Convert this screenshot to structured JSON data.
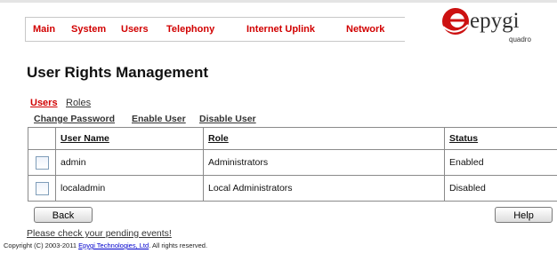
{
  "nav": {
    "items": [
      "Main",
      "System",
      "Users",
      "Telephony",
      "Internet Uplink",
      "Network"
    ]
  },
  "logo": {
    "text": "epygi",
    "subtext": "quadro"
  },
  "page": {
    "title": "User Rights Management"
  },
  "subtabs": {
    "users": "Users",
    "roles": "Roles"
  },
  "actions": {
    "change_password": "Change Password",
    "enable_user": "Enable User",
    "disable_user": "Disable User"
  },
  "table": {
    "headers": {
      "user_name": "User Name",
      "role": "Role",
      "status": "Status"
    },
    "rows": [
      {
        "user_name": "admin",
        "role": "Administrators",
        "status": "Enabled"
      },
      {
        "user_name": "localadmin",
        "role": "Local Administrators",
        "status": "Disabled"
      }
    ]
  },
  "buttons": {
    "back": "Back",
    "help": "Help"
  },
  "footer": {
    "pending": "Please check your pending events!",
    "copyright_prefix": "Copyright (C) 2003-2011",
    "copyright_link": "Epygi Technologies, Ltd",
    "copyright_suffix": ". All rights reserved."
  },
  "colors": {
    "accent": "#d10000",
    "logo_red": "#cc1111"
  }
}
